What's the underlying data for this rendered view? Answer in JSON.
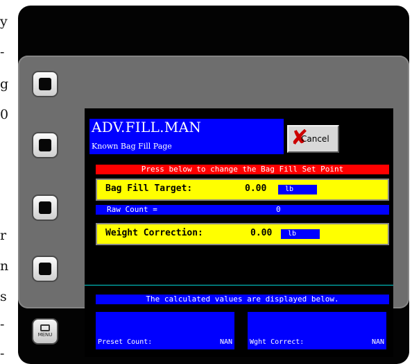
{
  "edge_fragments": [
    "y",
    "-",
    "g",
    "0",
    "r",
    "n",
    "s",
    "-",
    "-"
  ],
  "screen": {
    "title": "ADV.FILL.MAN",
    "subtitle": "Known Bag Fill Page",
    "cancel_label": "Cancel",
    "instruction": "Press below to change the Bag Fill Set Point",
    "bag_fill": {
      "label": "Bag Fill Target:",
      "value": "0.00",
      "unit": "lb"
    },
    "raw_count": {
      "label": "Raw Count =",
      "value": "0"
    },
    "weight_correction": {
      "label": "Weight Correction:",
      "value": "0.00",
      "unit": "lb"
    },
    "calc_notice": "The calculated values are displayed below.",
    "preset_count": {
      "label": "Preset Count:",
      "value": "NAN"
    },
    "wght_correct": {
      "label": "Wght Correct:",
      "value": "NAN"
    }
  },
  "menu_key_label": "MENU",
  "colors": {
    "screen_blue": "#0000ff",
    "field_yellow": "#ffff00",
    "banner_red": "#ff0000",
    "divider_cyan": "#00d5d5"
  }
}
